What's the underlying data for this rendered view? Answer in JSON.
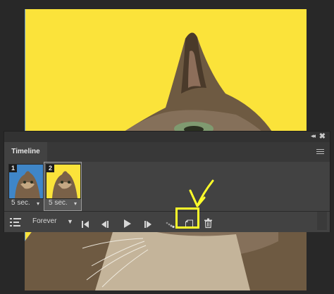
{
  "panel": {
    "tab_label": "Timeline",
    "collapse_glyph": "◂◂",
    "close_glyph": "✖"
  },
  "frames": [
    {
      "number": "1",
      "delay": "5 sec.",
      "selected": false,
      "thumb_bg": "#3f86c8"
    },
    {
      "number": "2",
      "delay": "5 sec.",
      "selected": true,
      "thumb_bg": "#fbe33a"
    }
  ],
  "controls": {
    "loop_label": "Forever"
  },
  "icons": [
    "convert-to-video-timeline-icon",
    "loop-dropdown-icon",
    "first-frame-icon",
    "previous-frame-icon",
    "play-icon",
    "next-frame-icon",
    "tween-icon",
    "duplicate-frame-icon",
    "trash-icon"
  ],
  "colors": {
    "canvas_background": "#fbe33a",
    "panel_background": "#424242",
    "highlight": "#ffff2a"
  }
}
